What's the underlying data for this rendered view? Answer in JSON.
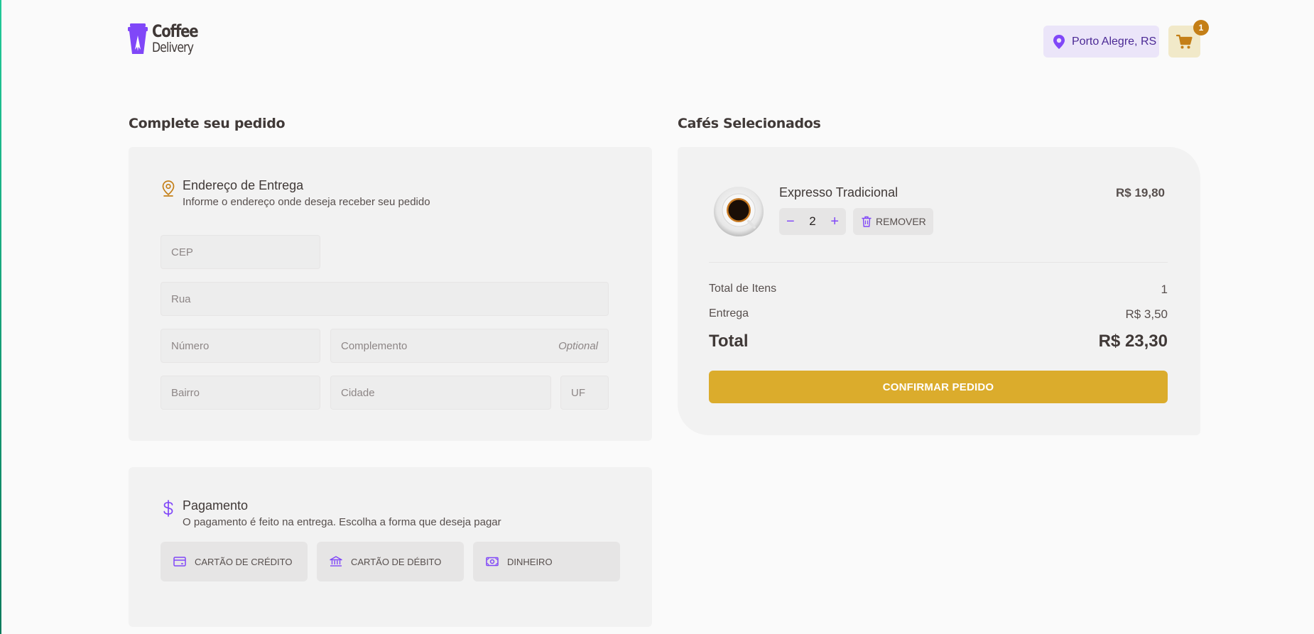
{
  "header": {
    "logo": {
      "line1": "Coffee",
      "line2": "Delivery"
    },
    "location": "Porto Alegre, RS",
    "cart_count": "1"
  },
  "checkout": {
    "title": "Complete seu pedido",
    "address": {
      "icon": "map-pin-icon",
      "title": "Endereço de Entrega",
      "subtitle": "Informe o endereço onde deseja receber seu pedido",
      "fields": {
        "cep": "CEP",
        "rua": "Rua",
        "numero": "Número",
        "complemento": "Complemento",
        "complemento_hint": "Optional",
        "bairro": "Bairro",
        "cidade": "Cidade",
        "uf": "UF"
      }
    },
    "payment": {
      "icon": "currency-dollar-icon",
      "title": "Pagamento",
      "subtitle": "O pagamento é feito na entrega. Escolha a forma que deseja pagar",
      "options": [
        {
          "label": "CARTÃO DE CRÉDITO",
          "icon": "credit-card-icon"
        },
        {
          "label": "CARTÃO DE DÉBITO",
          "icon": "bank-icon"
        },
        {
          "label": "DINHEIRO",
          "icon": "money-icon"
        }
      ]
    }
  },
  "cart": {
    "title": "Cafés Selecionados",
    "items": [
      {
        "name": "Expresso Tradicional",
        "price": "R$ 19,80",
        "quantity": "2",
        "remove_label": "REMOVER"
      }
    ],
    "totals": {
      "items_label": "Total de Itens",
      "items_value": "1",
      "delivery_label": "Entrega",
      "delivery_value": "R$ 3,50",
      "total_label": "Total",
      "total_value": "R$ 23,30"
    },
    "confirm_label": "CONFIRMAR PEDIDO"
  },
  "colors": {
    "purple": "#8047f8",
    "purple_dark": "#4b2995",
    "purple_light": "#ebe5f9",
    "yellow": "#dbac2c",
    "yellow_dark": "#c47f17",
    "yellow_light": "#f1e9c9"
  }
}
